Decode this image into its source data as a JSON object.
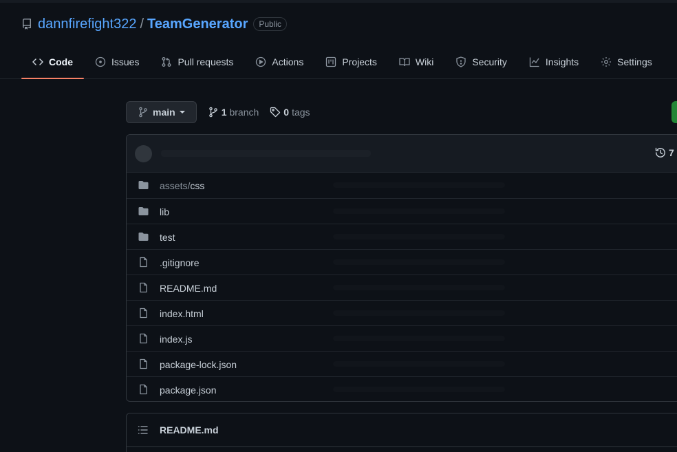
{
  "repo": {
    "owner": "dannfirefight322",
    "separator": "/",
    "name": "TeamGenerator",
    "visibility": "Public"
  },
  "tabs": [
    {
      "label": "Code",
      "icon": "code-icon",
      "active": true
    },
    {
      "label": "Issues",
      "icon": "issue-icon"
    },
    {
      "label": "Pull requests",
      "icon": "pull-request-icon"
    },
    {
      "label": "Actions",
      "icon": "play-icon"
    },
    {
      "label": "Projects",
      "icon": "project-icon"
    },
    {
      "label": "Wiki",
      "icon": "book-icon"
    },
    {
      "label": "Security",
      "icon": "shield-icon"
    },
    {
      "label": "Insights",
      "icon": "graph-icon"
    },
    {
      "label": "Settings",
      "icon": "gear-icon"
    }
  ],
  "toolbar": {
    "branch": "main",
    "branch_count": "1",
    "branch_label": "branch",
    "tag_count": "0",
    "tag_label": "tags"
  },
  "commits": {
    "count": "7"
  },
  "files": [
    {
      "type": "folder",
      "prefix": "assets/",
      "name": "css"
    },
    {
      "type": "folder",
      "prefix": "",
      "name": "lib"
    },
    {
      "type": "folder",
      "prefix": "",
      "name": "test"
    },
    {
      "type": "file",
      "prefix": "",
      "name": ".gitignore"
    },
    {
      "type": "file",
      "prefix": "",
      "name": "README.md"
    },
    {
      "type": "file",
      "prefix": "",
      "name": "index.html"
    },
    {
      "type": "file",
      "prefix": "",
      "name": "index.js"
    },
    {
      "type": "file",
      "prefix": "",
      "name": "package-lock.json"
    },
    {
      "type": "file",
      "prefix": "",
      "name": "package.json"
    }
  ],
  "readme": {
    "title": "README.md"
  },
  "colors": {
    "background": "#0d1117",
    "link": "#58a6ff",
    "active_tab_underline": "#f78166",
    "folder": "#8b949e",
    "green_button": "#238636"
  }
}
